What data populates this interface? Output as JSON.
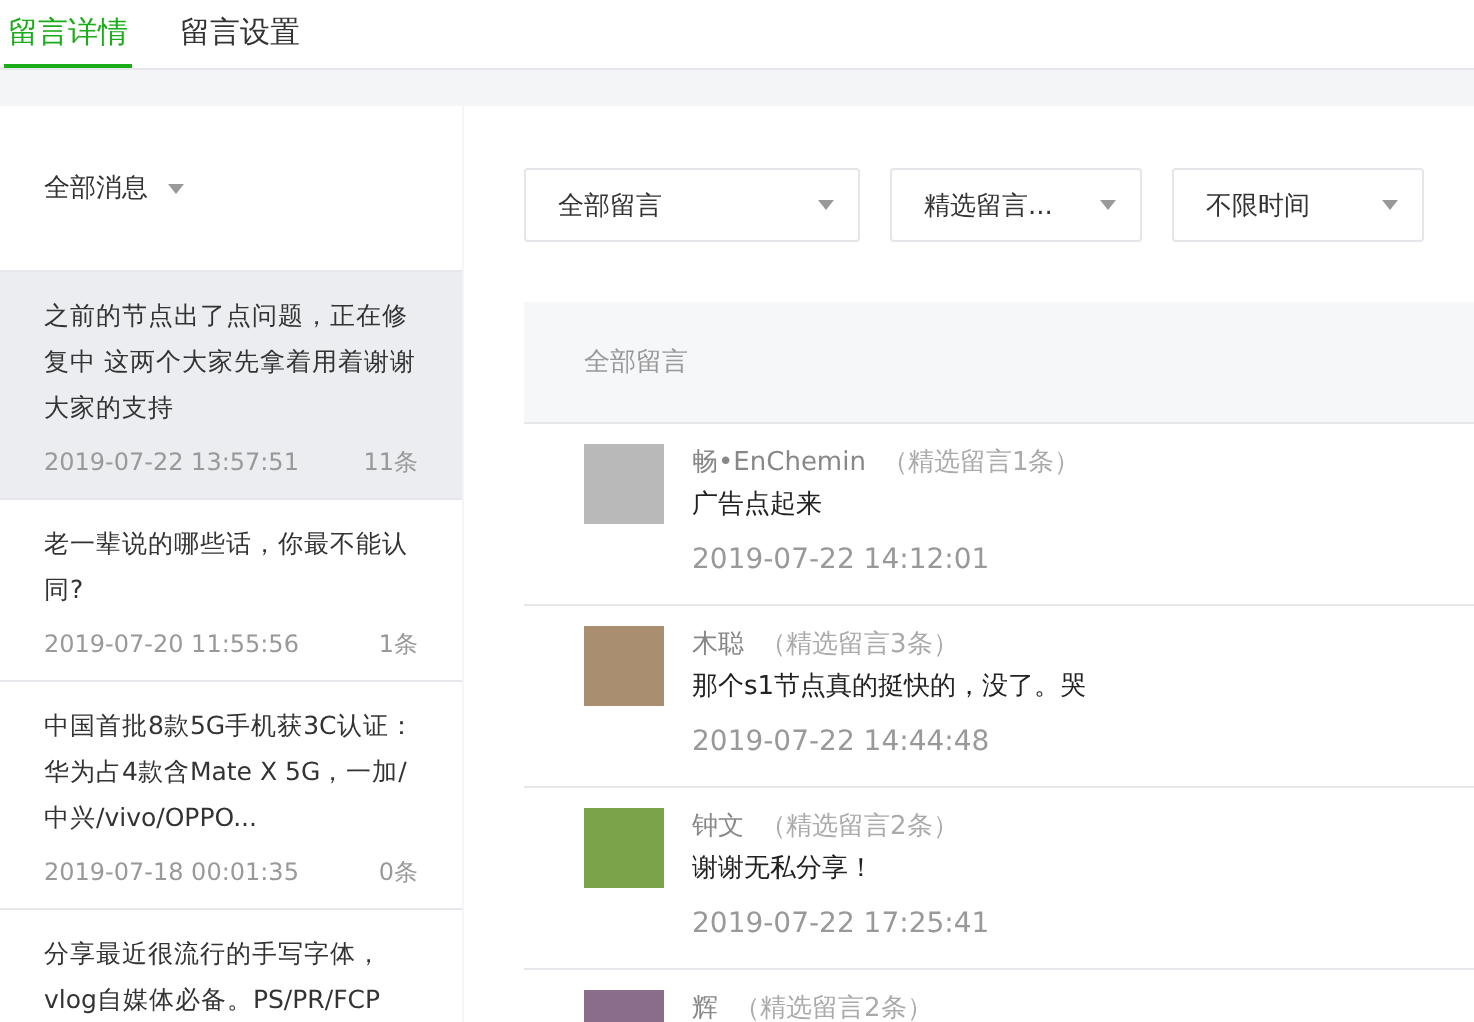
{
  "tabs": [
    {
      "label": "留言详情",
      "selected": true
    },
    {
      "label": "留言设置",
      "selected": false
    }
  ],
  "sidebar": {
    "filter": "全部消息",
    "items": [
      {
        "title": "之前的节点出了点问题，正在修复中 这两个大家先拿着用着谢谢大家的支持",
        "time": "2019-07-22 13:57:51",
        "count": "11条",
        "selected": true
      },
      {
        "title": "老一辈说的哪些话，你最不能认同?",
        "time": "2019-07-20 11:55:56",
        "count": "1条",
        "selected": false
      },
      {
        "title": "中国首批8款5G手机获3C认证：华为占4款含Mate X 5G，一加/中兴/vivo/OPPO...",
        "time": "2019-07-18 00:01:35",
        "count": "0条",
        "selected": false
      },
      {
        "title": "分享最近很流行的手写字体，vlog自媒体必备。PS/PR/FCP",
        "selected": false
      }
    ]
  },
  "filters": [
    "全部留言",
    "精选留言...",
    "不限时间"
  ],
  "comments_header": "全部留言",
  "comments": [
    {
      "name": "畅•EnChemin",
      "featured": "（精选留言1条）",
      "text": "广告点起来",
      "time": "2019-07-22 14:12:01"
    },
    {
      "name": "木聪",
      "featured": "（精选留言3条）",
      "text": "那个s1节点真的挺快的，没了。哭",
      "time": "2019-07-22 14:44:48"
    },
    {
      "name": "钟文",
      "featured": "（精选留言2条）",
      "text": "谢谢无私分享！",
      "time": "2019-07-22 17:25:41"
    },
    {
      "name": "辉",
      "featured": "（精选留言2条）"
    }
  ]
}
